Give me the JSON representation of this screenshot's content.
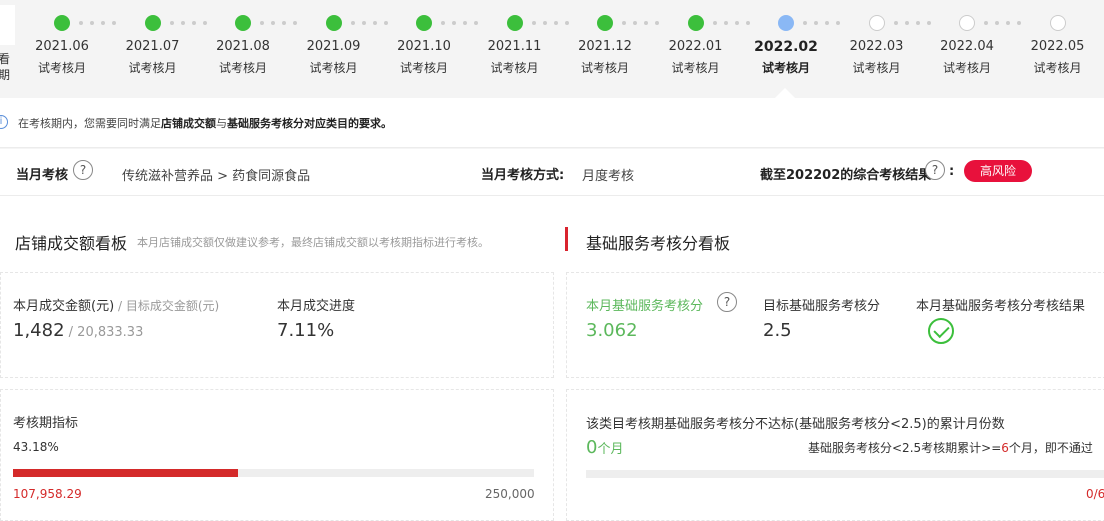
{
  "side_stub": {
    "line1": "看",
    "line2": "期"
  },
  "timeline": [
    {
      "date": "2021.06",
      "label": "试考核月",
      "status": "done"
    },
    {
      "date": "2021.07",
      "label": "试考核月",
      "status": "done"
    },
    {
      "date": "2021.08",
      "label": "试考核月",
      "status": "done"
    },
    {
      "date": "2021.09",
      "label": "试考核月",
      "status": "done"
    },
    {
      "date": "2021.10",
      "label": "试考核月",
      "status": "done"
    },
    {
      "date": "2021.11",
      "label": "试考核月",
      "status": "done"
    },
    {
      "date": "2021.12",
      "label": "试考核月",
      "status": "done"
    },
    {
      "date": "2022.01",
      "label": "试考核月",
      "status": "done"
    },
    {
      "date": "2022.02",
      "label": "试考核月",
      "status": "current"
    },
    {
      "date": "2022.03",
      "label": "试考核月",
      "status": "future"
    },
    {
      "date": "2022.04",
      "label": "试考核月",
      "status": "future"
    },
    {
      "date": "2022.05",
      "label": "试考核月",
      "status": "future"
    }
  ],
  "notice": {
    "prefix": "在考核期内，您需要同时满足",
    "strong1": "店铺成交额",
    "mid": "与",
    "strong2": "基础服务考核分对应类目的要求。"
  },
  "summary": {
    "monthly_label": "当月考核",
    "category": "传统滋补营养品 > 药食同源食品",
    "method_label": "当月考核方式:",
    "method_value": "月度考核",
    "result_label": "截至202202的综合考核结果",
    "colon": ":",
    "risk": "高风险"
  },
  "store_board": {
    "title": "店铺成交额看板",
    "subtitle": "本月店铺成交额仅做建议参考，最终店铺成交额以考核期指标进行考核。",
    "amount_label": "本月成交金额(元)",
    "target_label": " / 目标成交金额(元)",
    "amount": "1,482",
    "target": " / 20,833.33",
    "progress_label": "本月成交进度",
    "progress": "7.11%",
    "period_label": "考核期指标",
    "period_percent": "43.18%",
    "period_fraction": 0.4318,
    "period_current": "107,958.29",
    "period_target": "250,000"
  },
  "service_board": {
    "title": "基础服务考核分看板",
    "score_label": "本月基础服务考核分",
    "score": "3.062",
    "target_label": "目标基础服务考核分",
    "target": "2.5",
    "result_label": "本月基础服务考核分考核结果",
    "fail_label": "该类目考核期基础服务考核分不达标(基础服务考核分<2.5)的累计月份数",
    "fail_count": "0",
    "fail_unit": "个月",
    "rule_prefix": "基础服务考核分<2.5考核期累计>=",
    "rule_num": "6",
    "rule_suffix": "个月，即不通过",
    "fraction": "0/6"
  },
  "colors": {
    "done": "#3cbf3c",
    "current": "#8ab8f5",
    "risk": "#e8113c",
    "progress": "#d42a2a"
  }
}
